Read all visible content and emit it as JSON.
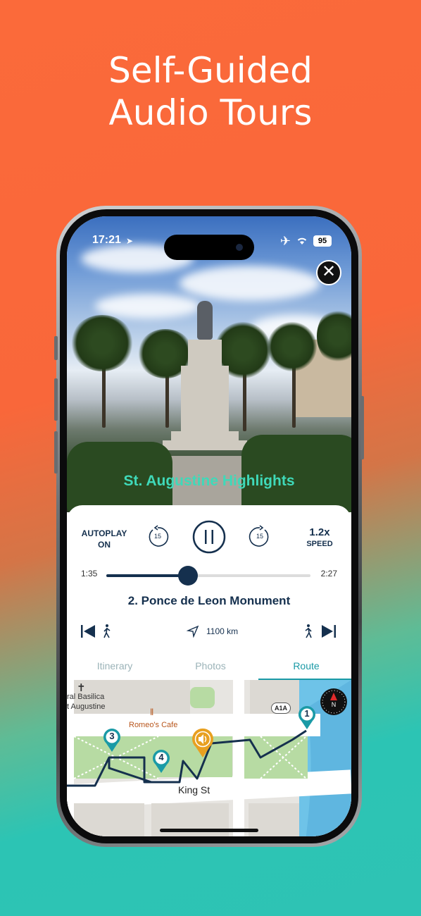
{
  "headline": {
    "line1": "Self-Guided",
    "line2": "Audio Tours"
  },
  "status_bar": {
    "time": "17:21",
    "battery": "95"
  },
  "tour": {
    "title": "St. Augustine Highlights"
  },
  "player": {
    "autoplay_line1": "AUTOPLAY",
    "autoplay_line2": "ON",
    "skip_back_seconds": "15",
    "skip_forward_seconds": "15",
    "speed_value": "1.2x",
    "speed_label": "SPEED",
    "elapsed": "1:35",
    "total": "2:27",
    "progress_fraction": 0.4,
    "stop_title": "2. Ponce de Leon Monument",
    "distance": "1100 km"
  },
  "tabs": [
    {
      "label": "Itinerary"
    },
    {
      "label": "Photos"
    },
    {
      "label": "Route"
    }
  ],
  "map": {
    "label_basilica_1": "ral Basilica",
    "label_basilica_2": "t Augustine",
    "cafe": "Romeo's Cafe",
    "street": "King St",
    "highway": "A1A",
    "compass": "N",
    "pins": [
      {
        "number": "1"
      },
      {
        "number": "3"
      },
      {
        "number": "4"
      }
    ]
  },
  "colors": {
    "accent_teal": "#1a9aa6",
    "title_teal": "#3fd9b9",
    "navy": "#15304e",
    "pin_orange": "#e8a020"
  }
}
